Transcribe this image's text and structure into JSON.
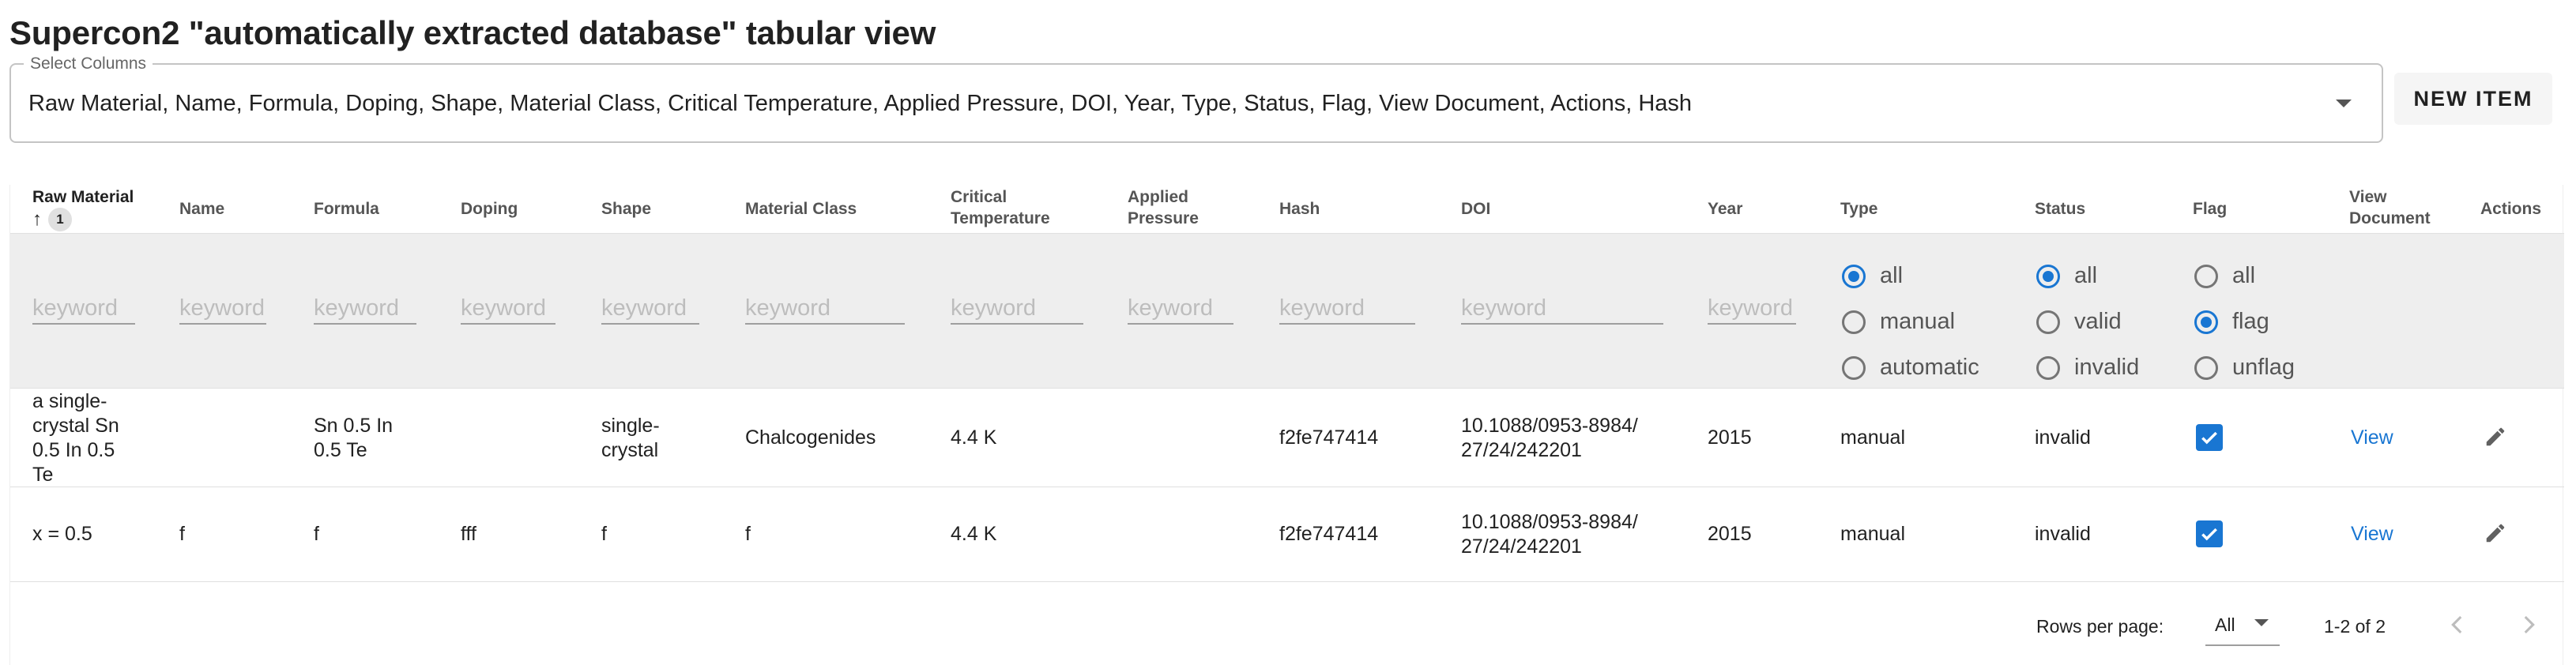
{
  "page": {
    "title": "Supercon2 \"automatically extracted database\" tabular view"
  },
  "column_select": {
    "label": "Select Columns",
    "value": "Raw Material, Name, Formula, Doping, Shape, Material Class, Critical Temperature, Applied Pressure, DOI, Year, Type, Status, Flag, View Document, Actions, Hash"
  },
  "toolbar": {
    "new_item_label": "NEW ITEM"
  },
  "table": {
    "headers": {
      "raw_material": "Raw Material",
      "name": "Name",
      "formula": "Formula",
      "doping": "Doping",
      "shape": "Shape",
      "material_class": "Material Class",
      "critical_temperature": "Critical Temperature",
      "applied_pressure": "Applied Pressure",
      "hash": "Hash",
      "doi": "DOI",
      "year": "Year",
      "type": "Type",
      "status": "Status",
      "flag": "Flag",
      "view_document": "View Document",
      "actions": "Actions"
    },
    "sort": {
      "column": "Raw Material",
      "direction": "ascending",
      "priority": "1"
    },
    "filters": {
      "keyword_placeholder": "keyword",
      "type": {
        "options": [
          "all",
          "manual",
          "automatic"
        ],
        "selected": "all"
      },
      "status": {
        "options": [
          "all",
          "valid",
          "invalid"
        ],
        "selected": "all"
      },
      "flag": {
        "options": [
          "all",
          "flag",
          "unflag"
        ],
        "selected": "flag"
      }
    },
    "rows": [
      {
        "raw_material": "a single-crystal Sn 0.5 In 0.5 Te",
        "name": "",
        "formula": "Sn 0.5 In 0.5 Te",
        "doping": "",
        "shape": "single-crystal",
        "material_class": "Chalcogenides",
        "critical_temperature": "4.4 K",
        "applied_pressure": "",
        "hash": "f2fe747414",
        "doi": "10.1088/0953-8984/27/24/242201",
        "year": "2015",
        "type": "manual",
        "status": "invalid",
        "flag": true,
        "view_label": "View",
        "action_icon": "pencil-icon"
      },
      {
        "raw_material": "x = 0.5",
        "name": "f",
        "formula": "f",
        "doping": "fff",
        "shape": "f",
        "material_class": "f",
        "critical_temperature": "4.4 K",
        "applied_pressure": "",
        "hash": "f2fe747414",
        "doi": "10.1088/0953-8984/27/24/242201",
        "year": "2015",
        "type": "manual",
        "status": "invalid",
        "flag": true,
        "view_label": "View",
        "action_icon": "pencil-icon"
      }
    ]
  },
  "pagination": {
    "rows_per_page_label": "Rows per page:",
    "rows_per_page_value": "All",
    "range_text": "1-2 of 2"
  },
  "colors": {
    "accent": "#1976d2",
    "filter_band": "#eeeeee",
    "text": "#212121",
    "muted": "#555555"
  }
}
